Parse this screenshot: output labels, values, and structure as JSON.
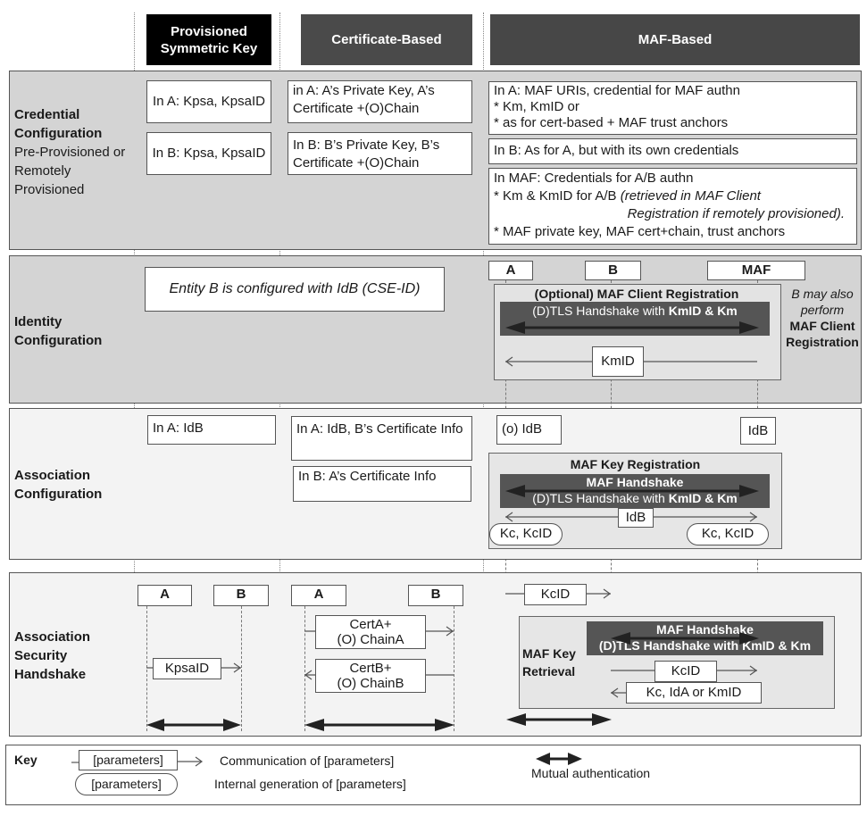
{
  "columns": {
    "psk": "Provisioned Symmetric Key",
    "cert": "Certificate-Based",
    "maf": "MAF-Based"
  },
  "rows": {
    "credential": {
      "title": "Credential Configuration",
      "subtitle": "Pre-Provisioned or Remotely Provisioned"
    },
    "identity": {
      "title": "Identity Configuration"
    },
    "association": {
      "title": "Association Configuration"
    },
    "handshake": {
      "title": "Association Security Handshake"
    }
  },
  "credential": {
    "psk_a": "In A: Kpsa, KpsaID",
    "psk_b": "In B: Kpsa, KpsaID",
    "cert_a": "in A: A’s Private Key, A’s Certificate +(O)Chain",
    "cert_b": "In B: B’s Private Key, B’s Certificate +(O)Chain",
    "maf_a": {
      "line1": "In A: MAF URIs, credential for MAF authn",
      "line2": "* Km, KmID or",
      "line3": "* as for cert-based + MAF trust anchors"
    },
    "maf_b": "In B: As for A, but with its own credentials",
    "maf_maf": {
      "line1": "In MAF: Credentials for A/B authn",
      "line2_prefix": "* Km & KmID for A/B ",
      "line2_italic": "(retrieved in MAF Client",
      "line3_italic": "Registration if remotely provisioned).",
      "line4": "* MAF private key, MAF cert+chain, trust anchors"
    }
  },
  "identity": {
    "entity_note": "Entity B is configured with IdB (CSE-ID)",
    "entities": {
      "a": "A",
      "b": "B",
      "maf": "MAF"
    },
    "client_registration": "(Optional) MAF Client Registration",
    "tls_prefix": "(D)TLS Handshake with ",
    "tls_bold": "KmID & Km",
    "kmid": "KmID",
    "side_note_italic": "B may also perform",
    "side_note_bold": "MAF Client Registration"
  },
  "association": {
    "psk_a": "In A: IdB",
    "cert_a": "In A: IdB, B’s Certificate Info",
    "cert_b": "In B: A’s Certificate Info",
    "maf_a": "(o) IdB",
    "maf_maf": "IdB",
    "key_registration": "MAF Key Registration",
    "maf_handshake": "MAF Handshake",
    "tls_prefix": "(D)TLS Handshake with ",
    "tls_bold": "KmID & Km",
    "idb": "IdB",
    "kc_left": "Kc, KcID",
    "kc_right": "Kc, KcID"
  },
  "handshake": {
    "psk_a": "A",
    "psk_b": "B",
    "kpsaid": "KpsaID",
    "cert_a": "A",
    "cert_b": "B",
    "certA_line1": "CertA+",
    "certA_line2": "(O) ChainA",
    "certB_line1": "CertB+",
    "certB_line2": "(O) ChainB",
    "kcid_top": "KcID",
    "key_retrieval": "MAF Key Retrieval",
    "maf_handshake": "MAF Handshake",
    "tls_text": "(D)TLS Handshake with KmID & Km",
    "kcid_inner": "KcID",
    "kc_reply": "Kc, IdA or KmID"
  },
  "key": {
    "title": "Key",
    "param_box": "[parameters]",
    "param_pill": "[parameters]",
    "communication": "Communication of [parameters]",
    "internal": "Internal generation of [parameters]",
    "mutual": "Mutual authentication"
  },
  "colors": {
    "psk_header": "#000000",
    "cert_header": "#4a4a4a",
    "maf_header": "#474747",
    "band_dark": "#d4d4d4",
    "band_light": "#f3f3f3",
    "bar": "#555555"
  }
}
